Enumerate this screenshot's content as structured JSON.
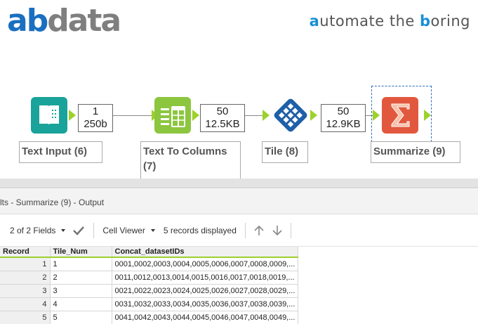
{
  "brand": {
    "logo_primary": "ab",
    "logo_secondary": "data"
  },
  "tagline": {
    "a": "a",
    "part1": "utomate the ",
    "b": "b",
    "part2": "oring"
  },
  "workflow": {
    "connections": [
      {
        "records": "1",
        "size": "250b"
      },
      {
        "records": "50",
        "size": "12.5KB"
      },
      {
        "records": "50",
        "size": "12.9KB"
      }
    ],
    "tools": [
      {
        "label": "Text Input (6)",
        "icon": "book-icon",
        "color": "#1aa39a"
      },
      {
        "label": "Text To Columns (7)",
        "icon": "columns-icon",
        "color": "#8cc63f"
      },
      {
        "label": "Tile (8)",
        "icon": "tile-icon",
        "color": "#1f5fa8"
      },
      {
        "label": "Summarize (9)",
        "icon": "sigma-icon",
        "color": "#e2583e"
      }
    ]
  },
  "results": {
    "title": "lts - Summarize (9) - Output",
    "fields_selector": "2 of 2 Fields",
    "viewer": "Cell Viewer",
    "records_displayed": "5 records displayed"
  },
  "grid": {
    "headers": [
      "Record",
      "Tile_Num",
      "Concat_datasetIDs"
    ],
    "rows": [
      [
        "1",
        "1",
        "0001,0002,0003,0004,0005,0006,0007,0008,0009,..."
      ],
      [
        "2",
        "2",
        "0011,0012,0013,0014,0015,0016,0017,0018,0019,..."
      ],
      [
        "3",
        "3",
        "0021,0022,0023,0024,0025,0026,0027,0028,0029,..."
      ],
      [
        "4",
        "4",
        "0031,0032,0033,0034,0035,0036,0037,0038,0039,..."
      ],
      [
        "5",
        "5",
        "0041,0042,0043,0044,0045,0046,0047,0048,0049,..."
      ]
    ]
  },
  "colors": {
    "accent": "#9dd12c",
    "brand_blue": "#1a6fc0",
    "selection": "#2a6db5"
  }
}
